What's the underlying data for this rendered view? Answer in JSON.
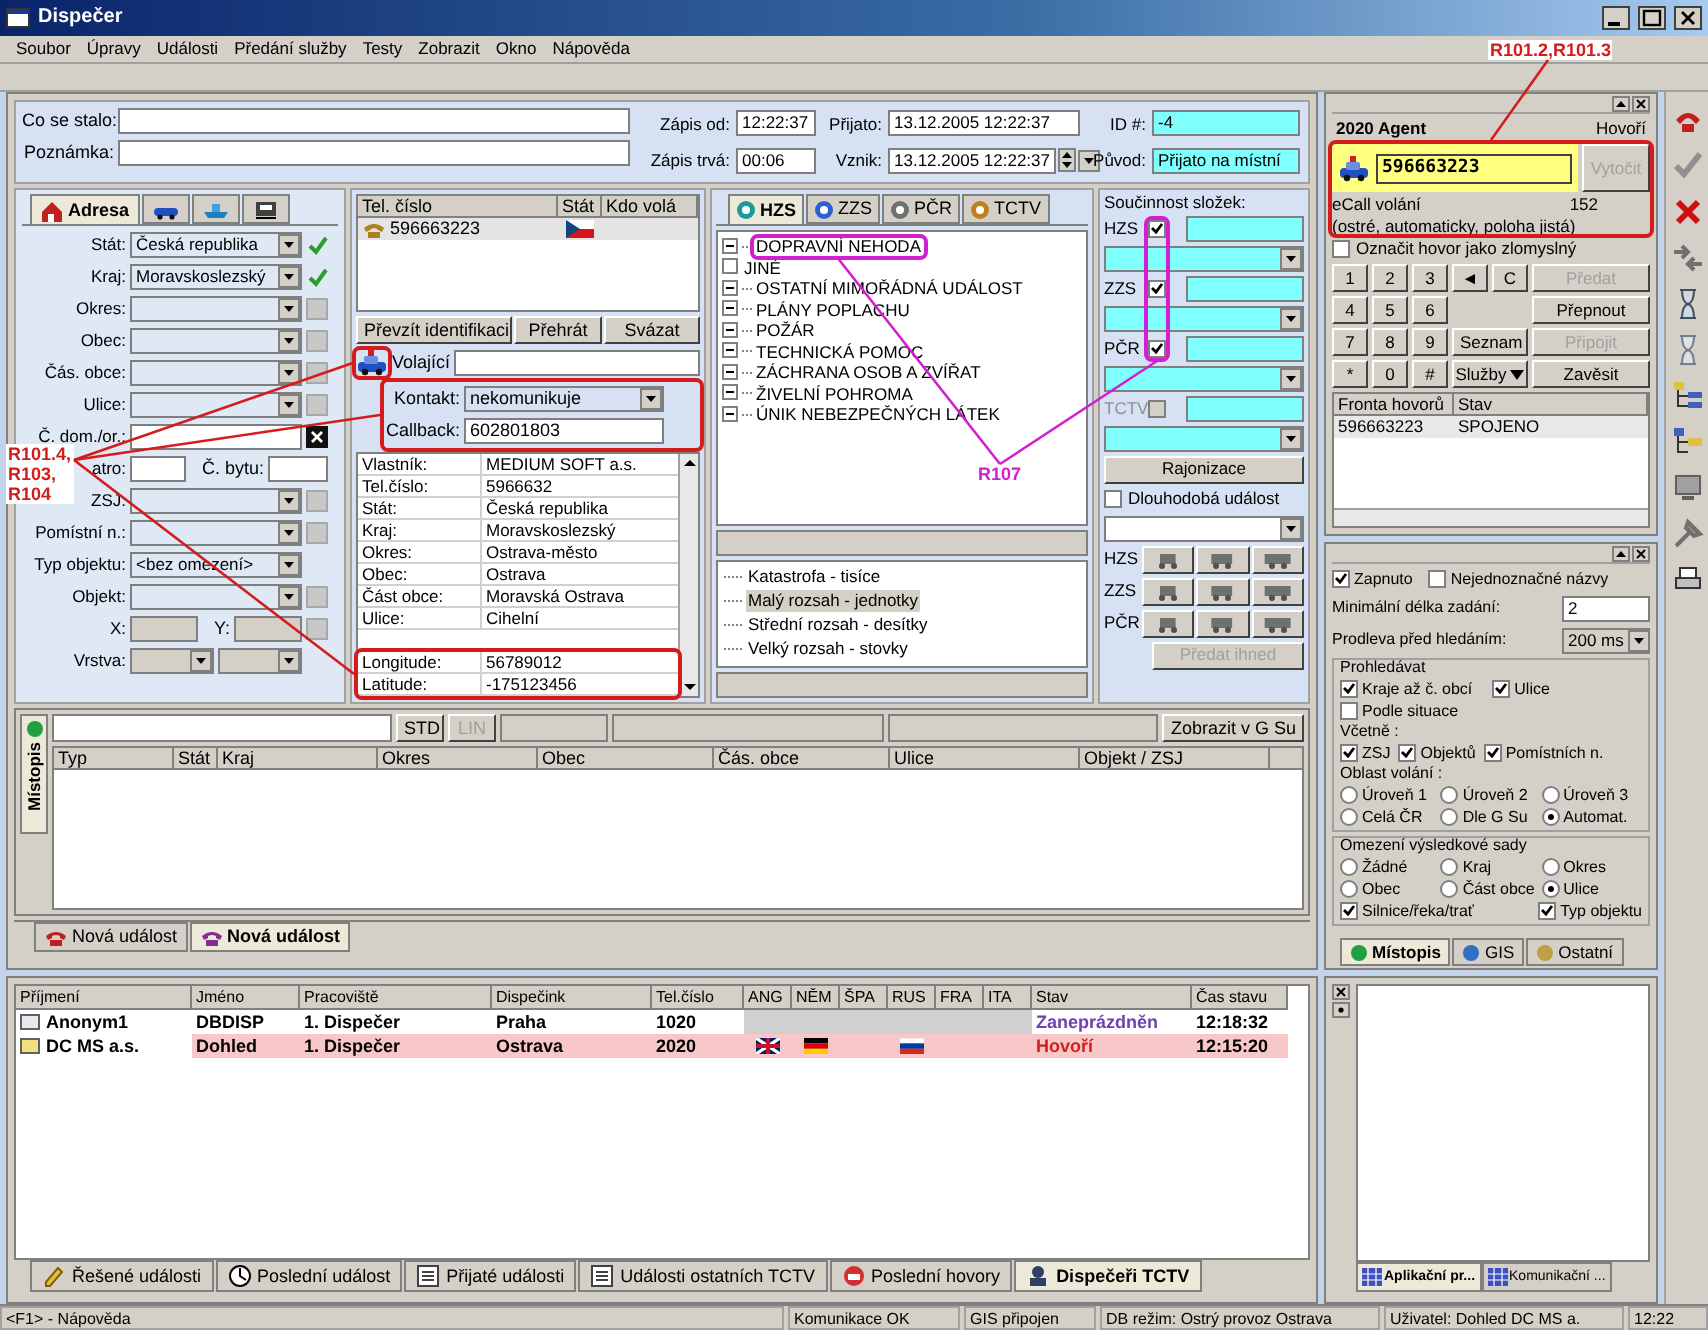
{
  "window": {
    "title": "Dispečer"
  },
  "menu": [
    "Soubor",
    "Úpravy",
    "Události",
    "Předání služby",
    "Testy",
    "Zobrazit",
    "Okno",
    "Nápověda"
  ],
  "header": {
    "fields": [
      {
        "label": "Co se stalo:"
      },
      {
        "label": "Poznámka:"
      }
    ],
    "times": [
      {
        "label": "Zápis od:",
        "value": "12:22:37",
        "highlighted": false,
        "kind": "text"
      },
      {
        "label": "Přijato:",
        "value": "13.12.2005 12:22:37",
        "highlighted": false,
        "kind": "text"
      },
      {
        "label": "ID #:",
        "value": "-4",
        "highlighted": true,
        "kind": "text"
      },
      {
        "label": "Zápis trvá:",
        "value": "00:06",
        "highlighted": false,
        "kind": "text"
      },
      {
        "label": "Vznik:",
        "value": "13.12.2005 12:22:37",
        "highlighted": false,
        "kind": "date"
      },
      {
        "label": "Původ:",
        "value": "Přijato na místní",
        "highlighted": true,
        "kind": "text"
      }
    ]
  },
  "address": {
    "tabs": [
      {
        "label": "Adresa",
        "selected": true,
        "kind": "house"
      },
      {
        "selected": false,
        "kind": "car"
      },
      {
        "selected": false,
        "kind": "boat"
      },
      {
        "selected": false,
        "kind": "train"
      }
    ],
    "fields": [
      {
        "kind": "combo",
        "label": "Stát:",
        "value": "Česká republika",
        "verified": true
      },
      {
        "kind": "combo",
        "label": "Kraj:",
        "value": "Moravskoslezský",
        "verified": true
      },
      {
        "kind": "combo",
        "label": "Okres:",
        "verified": false
      },
      {
        "kind": "combo",
        "label": "Obec:",
        "verified": false
      },
      {
        "kind": "combo",
        "label": "Čás. obce:",
        "verified": false
      },
      {
        "kind": "combo",
        "label": "Ulice:",
        "verified": false
      },
      {
        "kind": "clearable",
        "label": "Č. dom./or.:"
      },
      {
        "kind": "pair",
        "label": "atro:",
        "label2": "Č. bytu:"
      },
      {
        "kind": "combo",
        "label": "ZSJ:",
        "verified": false
      },
      {
        "kind": "combo",
        "label": "Pomístní n.:",
        "verified": false
      },
      {
        "kind": "combo",
        "label": "Typ objektu:",
        "value": "<bez omezení>"
      },
      {
        "kind": "combo",
        "label": "Objekt:",
        "verified": false
      },
      {
        "kind": "coords",
        "label": "X:",
        "label2": "Y:"
      },
      {
        "kind": "layer",
        "label": "Vrstva:"
      }
    ]
  },
  "caller": {
    "columns": [
      "Tel. číslo",
      "Stát",
      "Kdo volá"
    ],
    "rows": [
      {
        "number": "596663223"
      }
    ],
    "buttons": [
      "Převzít identifikaci",
      "Přehrát",
      "Svázat"
    ],
    "caller_label": "Volající",
    "contact": {
      "label": "Kontakt:",
      "value": "nekomunikuje"
    },
    "callback": {
      "label": "Callback:",
      "value": "602801803"
    },
    "details": [
      {
        "label": "Vlastník:",
        "value": "MEDIUM SOFT a.s."
      },
      {
        "label": "Tel.číslo:",
        "value": "5966632"
      },
      {
        "label": "Stát:",
        "value": "Česká republika"
      },
      {
        "label": "Kraj:",
        "value": "Moravskoslezský"
      },
      {
        "label": "Okres:",
        "value": "Ostrava-město"
      },
      {
        "label": "Obec:",
        "value": "Ostrava"
      },
      {
        "label": "Část obce:",
        "value": "Moravská Ostrava"
      },
      {
        "label": "Ulice:",
        "value": "Cihelní"
      }
    ],
    "coordinates": [
      {
        "label": "Longitude:",
        "value": "56789012"
      },
      {
        "label": "Latitude:",
        "value": "-175123456"
      }
    ]
  },
  "event_types": {
    "tabs": [
      {
        "label": "HZS",
        "selected": true
      },
      {
        "label": "ZZS",
        "selected": false
      },
      {
        "label": "PČR",
        "selected": false
      },
      {
        "label": "TCTV",
        "selected": false
      }
    ],
    "tree": [
      {
        "label": "DOPRAVNÍ NEHODA",
        "expandable": true
      },
      {
        "label": "JINÉ",
        "expandable": false
      },
      {
        "label": "OSTATNÍ MIMOŘÁDNÁ UDÁLOST",
        "expandable": true
      },
      {
        "label": "PLÁNY POPLACHU",
        "expandable": true
      },
      {
        "label": "POŽÁR",
        "expandable": true
      },
      {
        "label": "TECHNICKÁ POMOC",
        "expandable": true
      },
      {
        "label": "ZÁCHRANA OSOB A ZVÍŘAT",
        "expandable": true
      },
      {
        "label": "ŽIVELNÍ POHROMA",
        "expandable": true
      },
      {
        "label": "ÚNIK NEBEZPEČNÝCH LÁTEK",
        "expandable": true
      }
    ],
    "scale": [
      {
        "label": "Katastrofa - tisíce",
        "selected": false
      },
      {
        "label": "Malý rozsah - jednotky",
        "selected": true
      },
      {
        "label": "Střední rozsah - desítky",
        "selected": false
      },
      {
        "label": "Velký rozsah - stovky",
        "selected": false
      }
    ]
  },
  "cooperation": {
    "title": "Součinnost složek:",
    "units": [
      {
        "label": "HZS",
        "checked": true,
        "disabled": false
      },
      {
        "label": "ZZS",
        "checked": true,
        "disabled": false
      },
      {
        "label": "PČR",
        "checked": true,
        "disabled": false
      },
      {
        "label": "TCTV",
        "checked": false,
        "disabled": true
      }
    ],
    "zoning_button": "Rajonizace",
    "long_term": {
      "label": "Dlouhodobá událost",
      "checked": false
    },
    "dispatch_rows": [
      {
        "label": "HZS"
      },
      {
        "label": "ZZS"
      },
      {
        "label": "PČR"
      }
    ],
    "send_button": {
      "label": "Předat ihned",
      "disabled": true
    }
  },
  "locality": {
    "tab": "Místopis",
    "buttons": [
      {
        "label": "STD",
        "disabled": false
      },
      {
        "label": "LIN",
        "disabled": true
      },
      {
        "label": "Zobrazit v G Su",
        "disabled": false
      }
    ],
    "columns": [
      "Typ",
      "Stát",
      "Kraj",
      "Okres",
      "Obec",
      "Čás. obce",
      "Ulice",
      "Objekt / ZSJ"
    ]
  },
  "event_tabs": [
    {
      "label": "Nová událost",
      "selected": false
    },
    {
      "label": "Nová událost",
      "selected": true
    }
  ],
  "call_panel": {
    "agent": "2020 Agent",
    "state": "Hovoří",
    "number": "596663223",
    "dial_button": {
      "label": "Vytočit",
      "disabled": true
    },
    "ecall": {
      "title": "eCall volání",
      "code": "152",
      "detail": "(ostré, automaticky, poloha jistá)"
    },
    "malicious": {
      "label": "Označit hovor jako zlomyslný",
      "checked": false
    },
    "keypad": [
      [
        {
          "kind": "key",
          "label": "1",
          "disabled": false
        },
        {
          "kind": "key",
          "label": "2",
          "disabled": false
        },
        {
          "kind": "key",
          "label": "3",
          "disabled": false
        },
        {
          "kind": "key",
          "label": "◄",
          "disabled": false
        },
        {
          "kind": "key",
          "label": "C",
          "disabled": false
        },
        {
          "kind": "action",
          "label": "Předat",
          "disabled": true
        }
      ],
      [
        {
          "kind": "key",
          "label": "4",
          "disabled": false
        },
        {
          "kind": "key",
          "label": "5",
          "disabled": false
        },
        {
          "kind": "key",
          "label": "6",
          "disabled": false
        },
        {
          "kind": "spacer"
        },
        {
          "kind": "action",
          "label": "Přepnout",
          "disabled": false
        }
      ],
      [
        {
          "kind": "key",
          "label": "7",
          "disabled": false
        },
        {
          "kind": "key",
          "label": "8",
          "disabled": false
        },
        {
          "kind": "key",
          "label": "9",
          "disabled": false
        },
        {
          "kind": "wide",
          "label": "Seznam",
          "disabled": false
        },
        {
          "kind": "action",
          "label": "Připojit",
          "disabled": true
        }
      ],
      [
        {
          "kind": "key",
          "label": "*",
          "disabled": false
        },
        {
          "kind": "key",
          "label": "0",
          "disabled": false
        },
        {
          "kind": "key",
          "label": "#",
          "disabled": false
        },
        {
          "kind": "menu",
          "label": "Služby",
          "disabled": false
        },
        {
          "kind": "action",
          "label": "Zavěsit",
          "disabled": false
        }
      ]
    ],
    "queue": {
      "columns": [
        "Fronta hovorů",
        "Stav"
      ],
      "rows": [
        [
          "596663223",
          "SPOJENO"
        ]
      ]
    }
  },
  "search_options": {
    "toggles": [
      {
        "label": "Zapnuto",
        "checked": true
      },
      {
        "label": "Nejednoznačné názvy",
        "checked": false
      }
    ],
    "min_length": {
      "label": "Minimální délka zadání:",
      "value": "2"
    },
    "delay": {
      "label": "Prodleva před hledáním:",
      "value": "200 ms"
    },
    "search_in": {
      "title": "Prohledávat",
      "options": [
        {
          "label": "Kraje až č. obcí",
          "checked": true
        },
        {
          "label": "Ulice",
          "checked": true
        },
        {
          "label": "Podle situace",
          "checked": false
        }
      ],
      "include_title": "Včetně :",
      "include": [
        {
          "label": "ZSJ",
          "checked": true
        },
        {
          "label": "Objektů",
          "checked": true
        },
        {
          "label": "Pomístních n.",
          "checked": true
        }
      ],
      "area_title": "Oblast volání :",
      "area": [
        {
          "label": "Úroveň 1",
          "selected": false
        },
        {
          "label": "Úroveň 2",
          "selected": false
        },
        {
          "label": "Úroveň 3",
          "selected": false
        },
        {
          "label": "Celá ČR",
          "selected": false
        },
        {
          "label": "Dle G Su",
          "selected": false
        },
        {
          "label": "Automat.",
          "selected": true
        }
      ]
    },
    "limit": {
      "title": "Omezení výsledkové sady",
      "options": [
        {
          "label": "Žádné",
          "selected": false
        },
        {
          "label": "Kraj",
          "selected": false
        },
        {
          "label": "Okres",
          "selected": false
        },
        {
          "label": "Obec",
          "selected": false
        },
        {
          "label": "Část obce",
          "selected": false
        },
        {
          "label": "Ulice",
          "selected": true
        }
      ],
      "extras": [
        {
          "label": "Silnice/řeka/trať",
          "checked": true
        },
        {
          "label": "Typ objektu",
          "checked": true
        }
      ]
    },
    "tabs": [
      {
        "label": "Místopis",
        "selected": true
      },
      {
        "label": "GIS",
        "selected": false
      },
      {
        "label": "Ostatní",
        "selected": false
      }
    ]
  },
  "dispatchers": {
    "columns": [
      "Příjmení",
      "Jméno",
      "Pracoviště",
      "Dispečink",
      "Tel.číslo",
      "ANG",
      "NĚM",
      "ŠPA",
      "RUS",
      "FRA",
      "ITA",
      "Stav",
      "Čas stavu"
    ],
    "rows": [
      {
        "cells": [
          "Anonym1",
          "DBDISP",
          "1. Dispečer",
          "Praha",
          "1020"
        ],
        "languages": [
          false,
          false,
          false,
          false,
          false,
          false
        ],
        "status": "Zaneprázdněn",
        "highlighted": false,
        "time": "12:18:32"
      },
      {
        "cells": [
          "DC MS a.s.",
          "Dohled",
          "1. Dispečer",
          "Ostrava",
          "2020"
        ],
        "languages": [
          true,
          true,
          false,
          true,
          false,
          false
        ],
        "status": "Hovoří",
        "highlighted": true,
        "time": "12:15:20"
      }
    ],
    "tabs": [
      {
        "label": "Řešené události",
        "selected": false
      },
      {
        "label": "Poslední událost",
        "selected": false
      },
      {
        "label": "Přijaté události",
        "selected": false
      },
      {
        "label": "Události ostatních TCTV",
        "selected": false
      },
      {
        "label": "Poslední hovory",
        "selected": false
      },
      {
        "label": "Dispečeři TCTV",
        "selected": true
      }
    ]
  },
  "side_tabs": [
    {
      "label": "Aplikační pr...",
      "selected": true
    },
    {
      "label": "Komunikační ...",
      "selected": false
    }
  ],
  "status_bar": [
    "<F1> - Nápověda",
    "Komunikace OK",
    "GIS připojen",
    "DB režim: Ostrý provoz Ostrava",
    "Uživatel: Dohled DC MS a.",
    "12:22"
  ],
  "annotations": [
    {
      "label": "R101.2,R101.3",
      "color": "#d41c1c"
    },
    {
      "label": "R101.4, R103, R104",
      "color": "#d41c1c"
    },
    {
      "label": "R107",
      "color": "#d020d0"
    }
  ]
}
